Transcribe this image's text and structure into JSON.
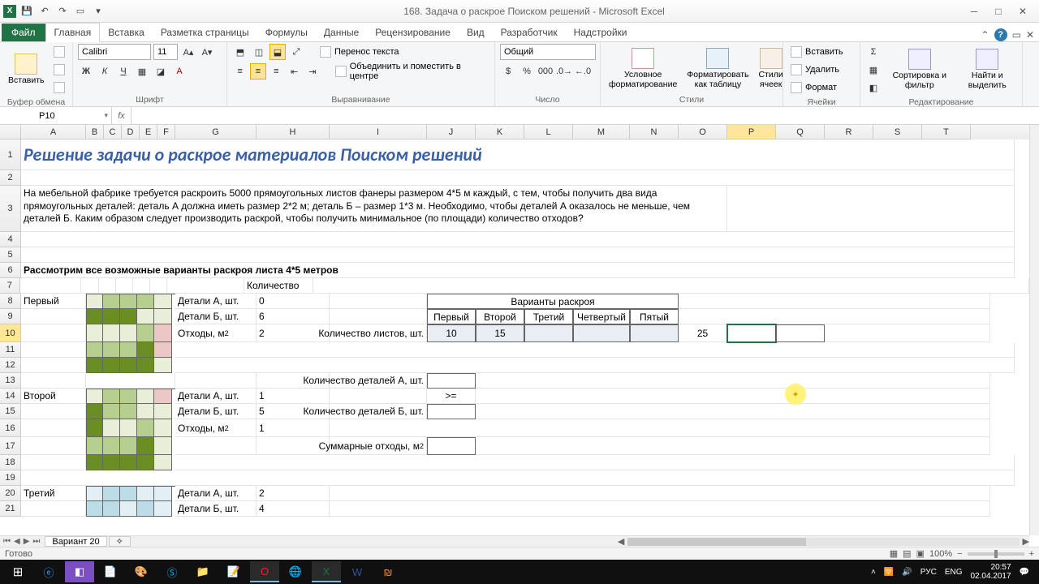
{
  "app": {
    "title": "168. Задача о раскрое Поиском решений - Microsoft Excel"
  },
  "ribbon": {
    "file": "Файл",
    "tabs": [
      "Главная",
      "Вставка",
      "Разметка страницы",
      "Формулы",
      "Данные",
      "Рецензирование",
      "Вид",
      "Разработчик",
      "Надстройки"
    ],
    "active_tab": 0,
    "groups": {
      "clipboard": "Буфер обмена",
      "paste": "Вставить",
      "font": "Шрифт",
      "font_name": "Calibri",
      "font_size": "11",
      "alignment": "Выравнивание",
      "wrap": "Перенос текста",
      "merge": "Объединить и поместить в центре",
      "number": "Число",
      "number_format": "Общий",
      "styles": "Стили",
      "cond_format": "Условное форматирование",
      "as_table": "Форматировать как таблицу",
      "cell_styles": "Стили ячеек",
      "cells": "Ячейки",
      "insert": "Вставить",
      "delete": "Удалить",
      "format": "Формат",
      "editing": "Редактирование",
      "sort_filter": "Сортировка и фильтр",
      "find_select": "Найти и выделить"
    }
  },
  "fbar": {
    "namebox": "P10",
    "fx": "fx",
    "formula": ""
  },
  "cols": [
    "A",
    "B",
    "C",
    "D",
    "E",
    "F",
    "G",
    "H",
    "I",
    "J",
    "K",
    "L",
    "M",
    "N",
    "O",
    "P",
    "Q",
    "R",
    "S",
    "T"
  ],
  "sheet": {
    "title": "Решение задачи о раскрое материалов Поиском решений",
    "problem": "На мебельной фабрике требуется раскроить 5000 прямоугольных листов фанеры размером 4*5 м каждый, с тем, чтобы получить два вида прямоугольных деталей: деталь А должна иметь размер 2*2 м; деталь Б – размер 1*3 м. Необходимо, чтобы деталей А оказалось не меньше, чем деталей Б. Каким образом следует производить раскрой, чтобы получить минимальное (по площади) количество отходов?",
    "consider": "Рассмотрим все возможные варианты раскроя листа 4*5 метров",
    "qty_header": "Количество",
    "variants_header": "Варианты раскроя",
    "variant_cols": [
      "Первый",
      "Второй",
      "Третий",
      "Четвертый",
      "Пятый"
    ],
    "sheets_row_label": "Количество листов, шт.",
    "sheets_row": [
      "10",
      "15",
      "",
      "",
      ""
    ],
    "sum_sheets": "25",
    "detA_label": "Количество деталей А, шт.",
    "ge": ">=",
    "detB_label": "Количество деталей Б, шт.",
    "total_waste": "Суммарные отходы, м",
    "v1": {
      "name": "Первый",
      "a": "Детали А, шт.",
      "av": "0",
      "b": "Детали Б, шт.",
      "bv": "6",
      "w": "Отходы, м",
      "wv": "2"
    },
    "v2": {
      "name": "Второй",
      "a": "Детали А, шт.",
      "av": "1",
      "b": "Детали Б, шт.",
      "bv": "5",
      "w": "Отходы, м",
      "wv": "1"
    },
    "v3": {
      "name": "Третий",
      "a": "Детали А, шт.",
      "av": "2",
      "b": "Детали Б, шт.",
      "bv": "4"
    }
  },
  "tabs": {
    "sheet": "Вариант 20"
  },
  "status": {
    "ready": "Готово",
    "zoom": "100%"
  },
  "tray": {
    "lang": "РУС",
    "kb": "ENG",
    "time": "20:57",
    "date": "02.04.2017"
  }
}
